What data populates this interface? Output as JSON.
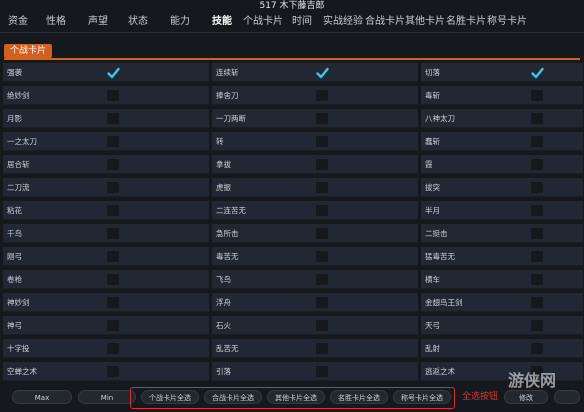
{
  "window": {
    "title": "517 木下藤吉郎"
  },
  "tabs": [
    {
      "label": "资金"
    },
    {
      "label": "性格"
    },
    {
      "label": "声望"
    },
    {
      "label": "状态"
    },
    {
      "label": "能力"
    },
    {
      "label": "技能"
    },
    {
      "label": "个战卡片"
    },
    {
      "label": "时间"
    },
    {
      "label": "实战经验"
    },
    {
      "label": "合战卡片"
    },
    {
      "label": "其他卡片"
    },
    {
      "label": "名胜卡片"
    },
    {
      "label": "称号卡片"
    }
  ],
  "active_tab": "技能",
  "section": {
    "label": "个战卡片"
  },
  "skills": [
    [
      "强袭",
      true,
      "连续斩",
      true,
      "切落",
      true
    ],
    [
      "绝妙剑",
      false,
      "捧舍刀",
      false,
      "毒斩",
      false
    ],
    [
      "月影",
      false,
      "一刀两断",
      false,
      "八神太刀",
      false
    ],
    [
      "一之太刀",
      false,
      "转",
      false,
      "蠢斩",
      false
    ],
    [
      "居合斩",
      false,
      "拿拔",
      false,
      "霞",
      false
    ],
    [
      "二刀流",
      false,
      "虎振",
      false,
      "拔突",
      false
    ],
    [
      "粘花",
      false,
      "二连苦无",
      false,
      "半月",
      false
    ],
    [
      "千鸟",
      false,
      "急所击",
      false,
      "二挺击",
      false
    ],
    [
      "刚弓",
      false,
      "毒苦无",
      false,
      "猛毒苦无",
      false
    ],
    [
      "卷枪",
      false,
      "飞鸟",
      false,
      "横车",
      false
    ],
    [
      "神妙剑",
      false,
      "浮舟",
      false,
      "金翅鸟王剑",
      false
    ],
    [
      "神弓",
      false,
      "石火",
      false,
      "天弓",
      false
    ],
    [
      "十字投",
      false,
      "乱苦无",
      false,
      "乱射",
      false
    ],
    [
      "空蝉之术",
      false,
      "引落",
      false,
      "逃返之术",
      false
    ]
  ],
  "bottom": {
    "max_label": "Max",
    "min_label": "Min",
    "select_all_buttons": [
      "个战卡片全选",
      "合战卡片全选",
      "其他卡片全选",
      "名胜卡片全选",
      "称号卡片全选"
    ],
    "annotation": "全选按钮",
    "modify_label": "修改",
    "watermark": "游侠网"
  },
  "colors": {
    "accent": "#d2601f",
    "check": "#3ec3ea",
    "highlight_box": "#d23232",
    "background": "#15181d",
    "cell": "#222833"
  }
}
